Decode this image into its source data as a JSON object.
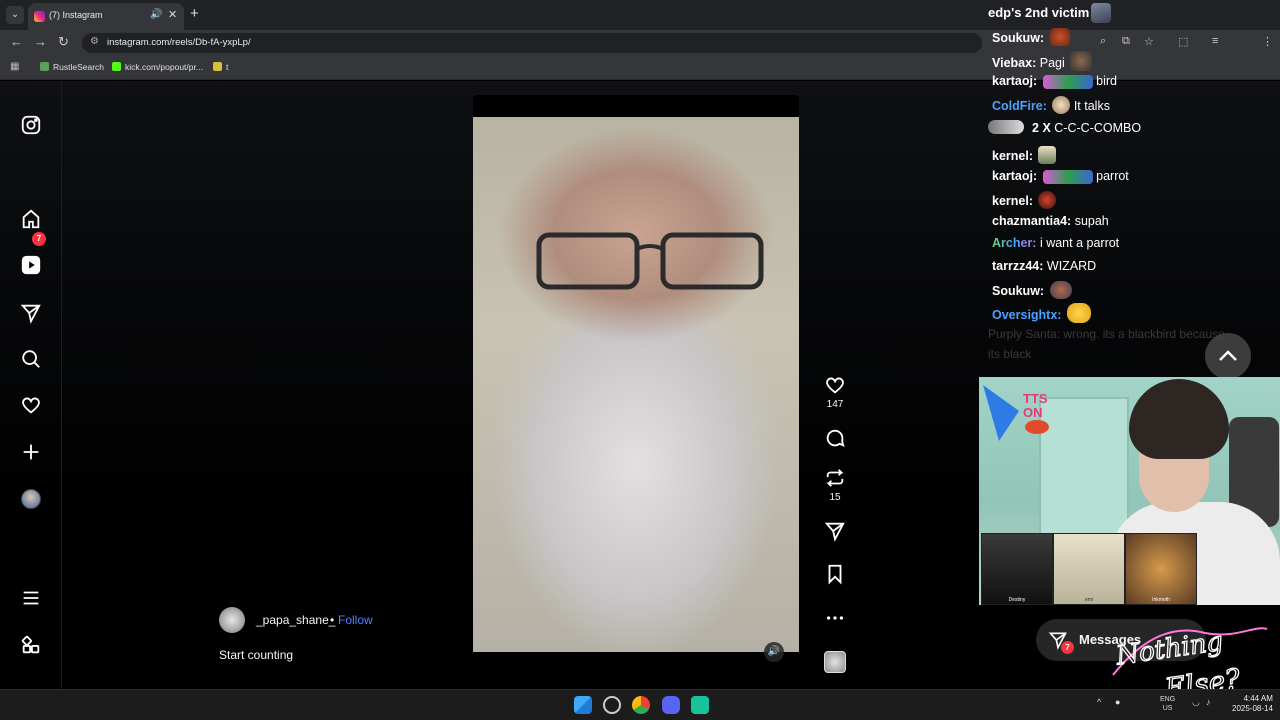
{
  "browser": {
    "tab_title": "(7) Instagram",
    "url": "instagram.com/reels/Db-fA-yxpLp/",
    "bookmarks": [
      {
        "label": "RustleSearch",
        "color": "#5aa05a"
      },
      {
        "label": "kick.com/popout/pr...",
        "color": "#53fc18"
      },
      {
        "label": "t",
        "color": "#d8c13a"
      }
    ]
  },
  "instagram": {
    "notification_badge": "7",
    "reel": {
      "username": "_papa_shane_",
      "separator": "•",
      "follow_label": "Follow",
      "caption": "Start counting",
      "likes": "147",
      "reposts": "15"
    },
    "messages": {
      "label": "Messages",
      "badge": "7"
    }
  },
  "stream_overlay": {
    "chat_header": "edp's 2nd victim",
    "chat": [
      {
        "name": "Soukuw:",
        "text": "",
        "color": "#ffffff"
      },
      {
        "name": "Viebax:",
        "text": "Pagi",
        "color": "#ffffff"
      },
      {
        "name": "kartaoj:",
        "text": "bird",
        "color": "#ffffff"
      },
      {
        "name": "ColdFire:",
        "text": "It talks",
        "color": "#4aa3ff"
      },
      {
        "name": "kernel:",
        "text": "",
        "color": "#ffffff"
      },
      {
        "name": "kartaoj:",
        "text": "parrot",
        "color": "#ffffff"
      },
      {
        "name": "kernel:",
        "text": "",
        "color": "#ffffff"
      },
      {
        "name": "chazmantia4:",
        "text": "supah",
        "color": "#ffffff"
      },
      {
        "name": "Archer:",
        "text": "i want a parrot",
        "color": "#6fd96f"
      },
      {
        "name": "tarrzz44:",
        "text": "WIZARD",
        "color": "#ffffff"
      },
      {
        "name": "Soukuw:",
        "text": "",
        "color": "#ffffff"
      },
      {
        "name": "Oversightx:",
        "text": "",
        "color": "#4aa3ff"
      }
    ],
    "combo": {
      "count": "2",
      "x": "X",
      "label": "C-C-C-COMBO"
    },
    "faded_lines": [
      "Purply Santa: wrong. its a blackbird because",
      "its black"
    ],
    "tts_label": "TTS ON",
    "cam_thumbs": [
      "Destiny",
      "emi",
      "Inkmoth"
    ],
    "logo_text": "Nothing Else?"
  },
  "taskbar": {
    "lang": [
      "ENG",
      "US"
    ],
    "time": "4:44 AM",
    "date": "2025-08-14"
  }
}
